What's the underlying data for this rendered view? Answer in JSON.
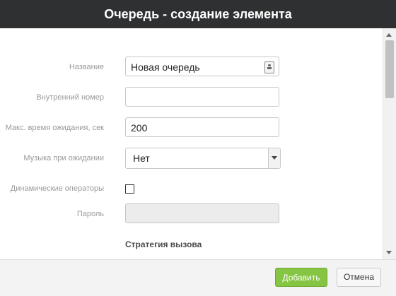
{
  "dialog": {
    "title": "Очередь - создание элемента"
  },
  "form": {
    "name": {
      "label": "Название",
      "value": "Новая очередь",
      "icon": "contact-card-icon"
    },
    "internal_number": {
      "label": "Внутренний номер",
      "value": ""
    },
    "max_wait": {
      "label": "Макс. время ожидания, сек",
      "value": "200"
    },
    "hold_music": {
      "label": "Музыка при ожидании",
      "selected": "Нет"
    },
    "dynamic_operators": {
      "label": "Динамические операторы",
      "checked": false
    },
    "password": {
      "label": "Пароль",
      "value": ""
    },
    "section_title": "Стратегия вызова"
  },
  "footer": {
    "add_label": "Добавить",
    "cancel_label": "Отмена"
  },
  "colors": {
    "title_bg": "#2f3031",
    "add_button": "#86c543"
  }
}
